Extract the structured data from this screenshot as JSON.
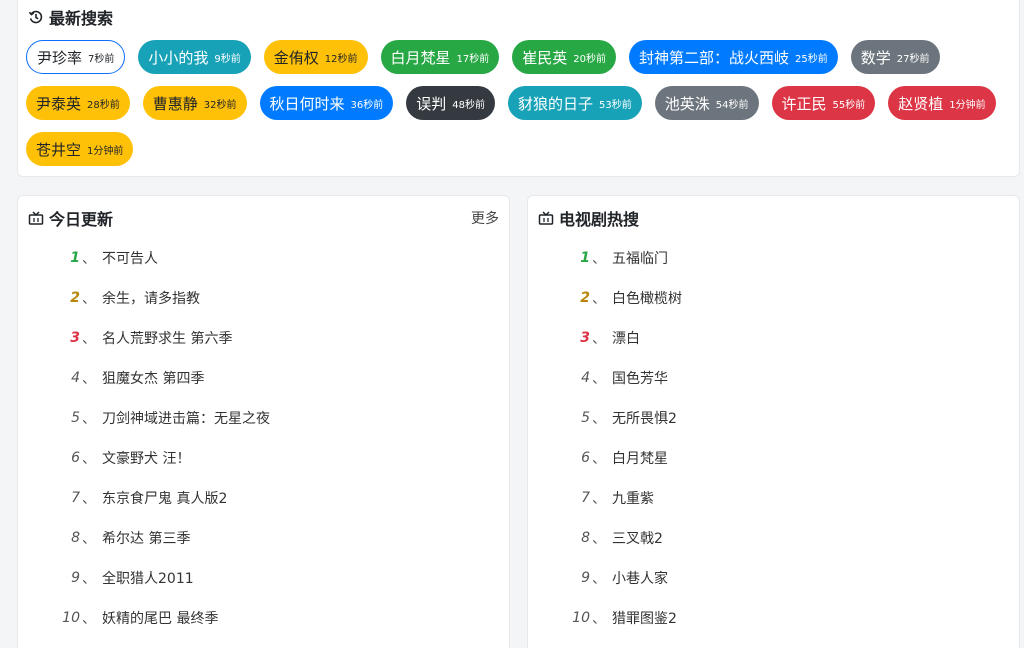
{
  "recent": {
    "title": "最新搜索",
    "icon": "history-icon",
    "tags": [
      {
        "name": "尹珍率",
        "time": "7秒前",
        "bg": "#ffffff",
        "fg": "#212529",
        "outline": true
      },
      {
        "name": "小小的我",
        "time": "9秒前",
        "bg": "#17a2b8",
        "fg": "#ffffff"
      },
      {
        "name": "金侑权",
        "time": "12秒前",
        "bg": "#ffc107",
        "fg": "#212529"
      },
      {
        "name": "白月梵星",
        "time": "17秒前",
        "bg": "#28a745",
        "fg": "#ffffff"
      },
      {
        "name": "崔民英",
        "time": "20秒前",
        "bg": "#28a745",
        "fg": "#ffffff"
      },
      {
        "name": "封神第二部：战火西岐",
        "time": "25秒前",
        "bg": "#007bff",
        "fg": "#ffffff"
      },
      {
        "name": "数学",
        "time": "27秒前",
        "bg": "#6c757d",
        "fg": "#ffffff"
      },
      {
        "name": "尹泰英",
        "time": "28秒前",
        "bg": "#ffc107",
        "fg": "#212529"
      },
      {
        "name": "曹惠静",
        "time": "32秒前",
        "bg": "#ffc107",
        "fg": "#212529"
      },
      {
        "name": "秋日何时来",
        "time": "36秒前",
        "bg": "#007bff",
        "fg": "#ffffff"
      },
      {
        "name": "误判",
        "time": "48秒前",
        "bg": "#343a40",
        "fg": "#ffffff"
      },
      {
        "name": "豺狼的日子",
        "time": "53秒前",
        "bg": "#17a2b8",
        "fg": "#ffffff"
      },
      {
        "name": "池英洙",
        "time": "54秒前",
        "bg": "#6c757d",
        "fg": "#ffffff"
      },
      {
        "name": "许正民",
        "time": "55秒前",
        "bg": "#dc3545",
        "fg": "#ffffff"
      },
      {
        "name": "赵贤植",
        "time": "1分钟前",
        "bg": "#dc3545",
        "fg": "#ffffff"
      },
      {
        "name": "苍井空",
        "time": "1分钟前",
        "bg": "#ffc107",
        "fg": "#212529"
      }
    ]
  },
  "today": {
    "title": "今日更新",
    "icon": "tv-icon",
    "more": "更多",
    "items": [
      {
        "num": "1",
        "sep": "、",
        "title": "不可告人",
        "color": "#28a745"
      },
      {
        "num": "2",
        "sep": "、",
        "title": "余生，请多指教",
        "color": "#b8860b"
      },
      {
        "num": "3",
        "sep": "、",
        "title": "名人荒野求生 第六季",
        "color": "#dc3545"
      },
      {
        "num": "4",
        "sep": "、",
        "title": "狙魔女杰 第四季",
        "color": "#555555"
      },
      {
        "num": "5",
        "sep": "、",
        "title": "刀剑神域进击篇：无星之夜",
        "color": "#555555"
      },
      {
        "num": "6",
        "sep": "、",
        "title": "文豪野犬 汪！",
        "color": "#555555"
      },
      {
        "num": "7",
        "sep": "、",
        "title": "东京食尸鬼 真人版2",
        "color": "#555555"
      },
      {
        "num": "8",
        "sep": "、",
        "title": "希尔达 第三季",
        "color": "#555555"
      },
      {
        "num": "9",
        "sep": "、",
        "title": "全职猎人2011",
        "color": "#555555"
      },
      {
        "num": "10",
        "sep": "、",
        "title": "妖精的尾巴 最终季",
        "color": "#555555"
      }
    ]
  },
  "tv": {
    "title": "电视剧热搜",
    "icon": "tv-icon",
    "items": [
      {
        "num": "1",
        "sep": "、",
        "title": "五福临门",
        "color": "#28a745"
      },
      {
        "num": "2",
        "sep": "、",
        "title": "白色橄榄树",
        "color": "#b8860b"
      },
      {
        "num": "3",
        "sep": "、",
        "title": "漂白",
        "color": "#dc3545"
      },
      {
        "num": "4",
        "sep": "、",
        "title": "国色芳华",
        "color": "#555555"
      },
      {
        "num": "5",
        "sep": "、",
        "title": "无所畏惧2",
        "color": "#555555"
      },
      {
        "num": "6",
        "sep": "、",
        "title": "白月梵星",
        "color": "#555555"
      },
      {
        "num": "7",
        "sep": "、",
        "title": "九重紫",
        "color": "#555555"
      },
      {
        "num": "8",
        "sep": "、",
        "title": "三叉戟2",
        "color": "#555555"
      },
      {
        "num": "9",
        "sep": "、",
        "title": "小巷人家",
        "color": "#555555"
      },
      {
        "num": "10",
        "sep": "、",
        "title": "猎罪图鉴2",
        "color": "#555555"
      }
    ]
  }
}
